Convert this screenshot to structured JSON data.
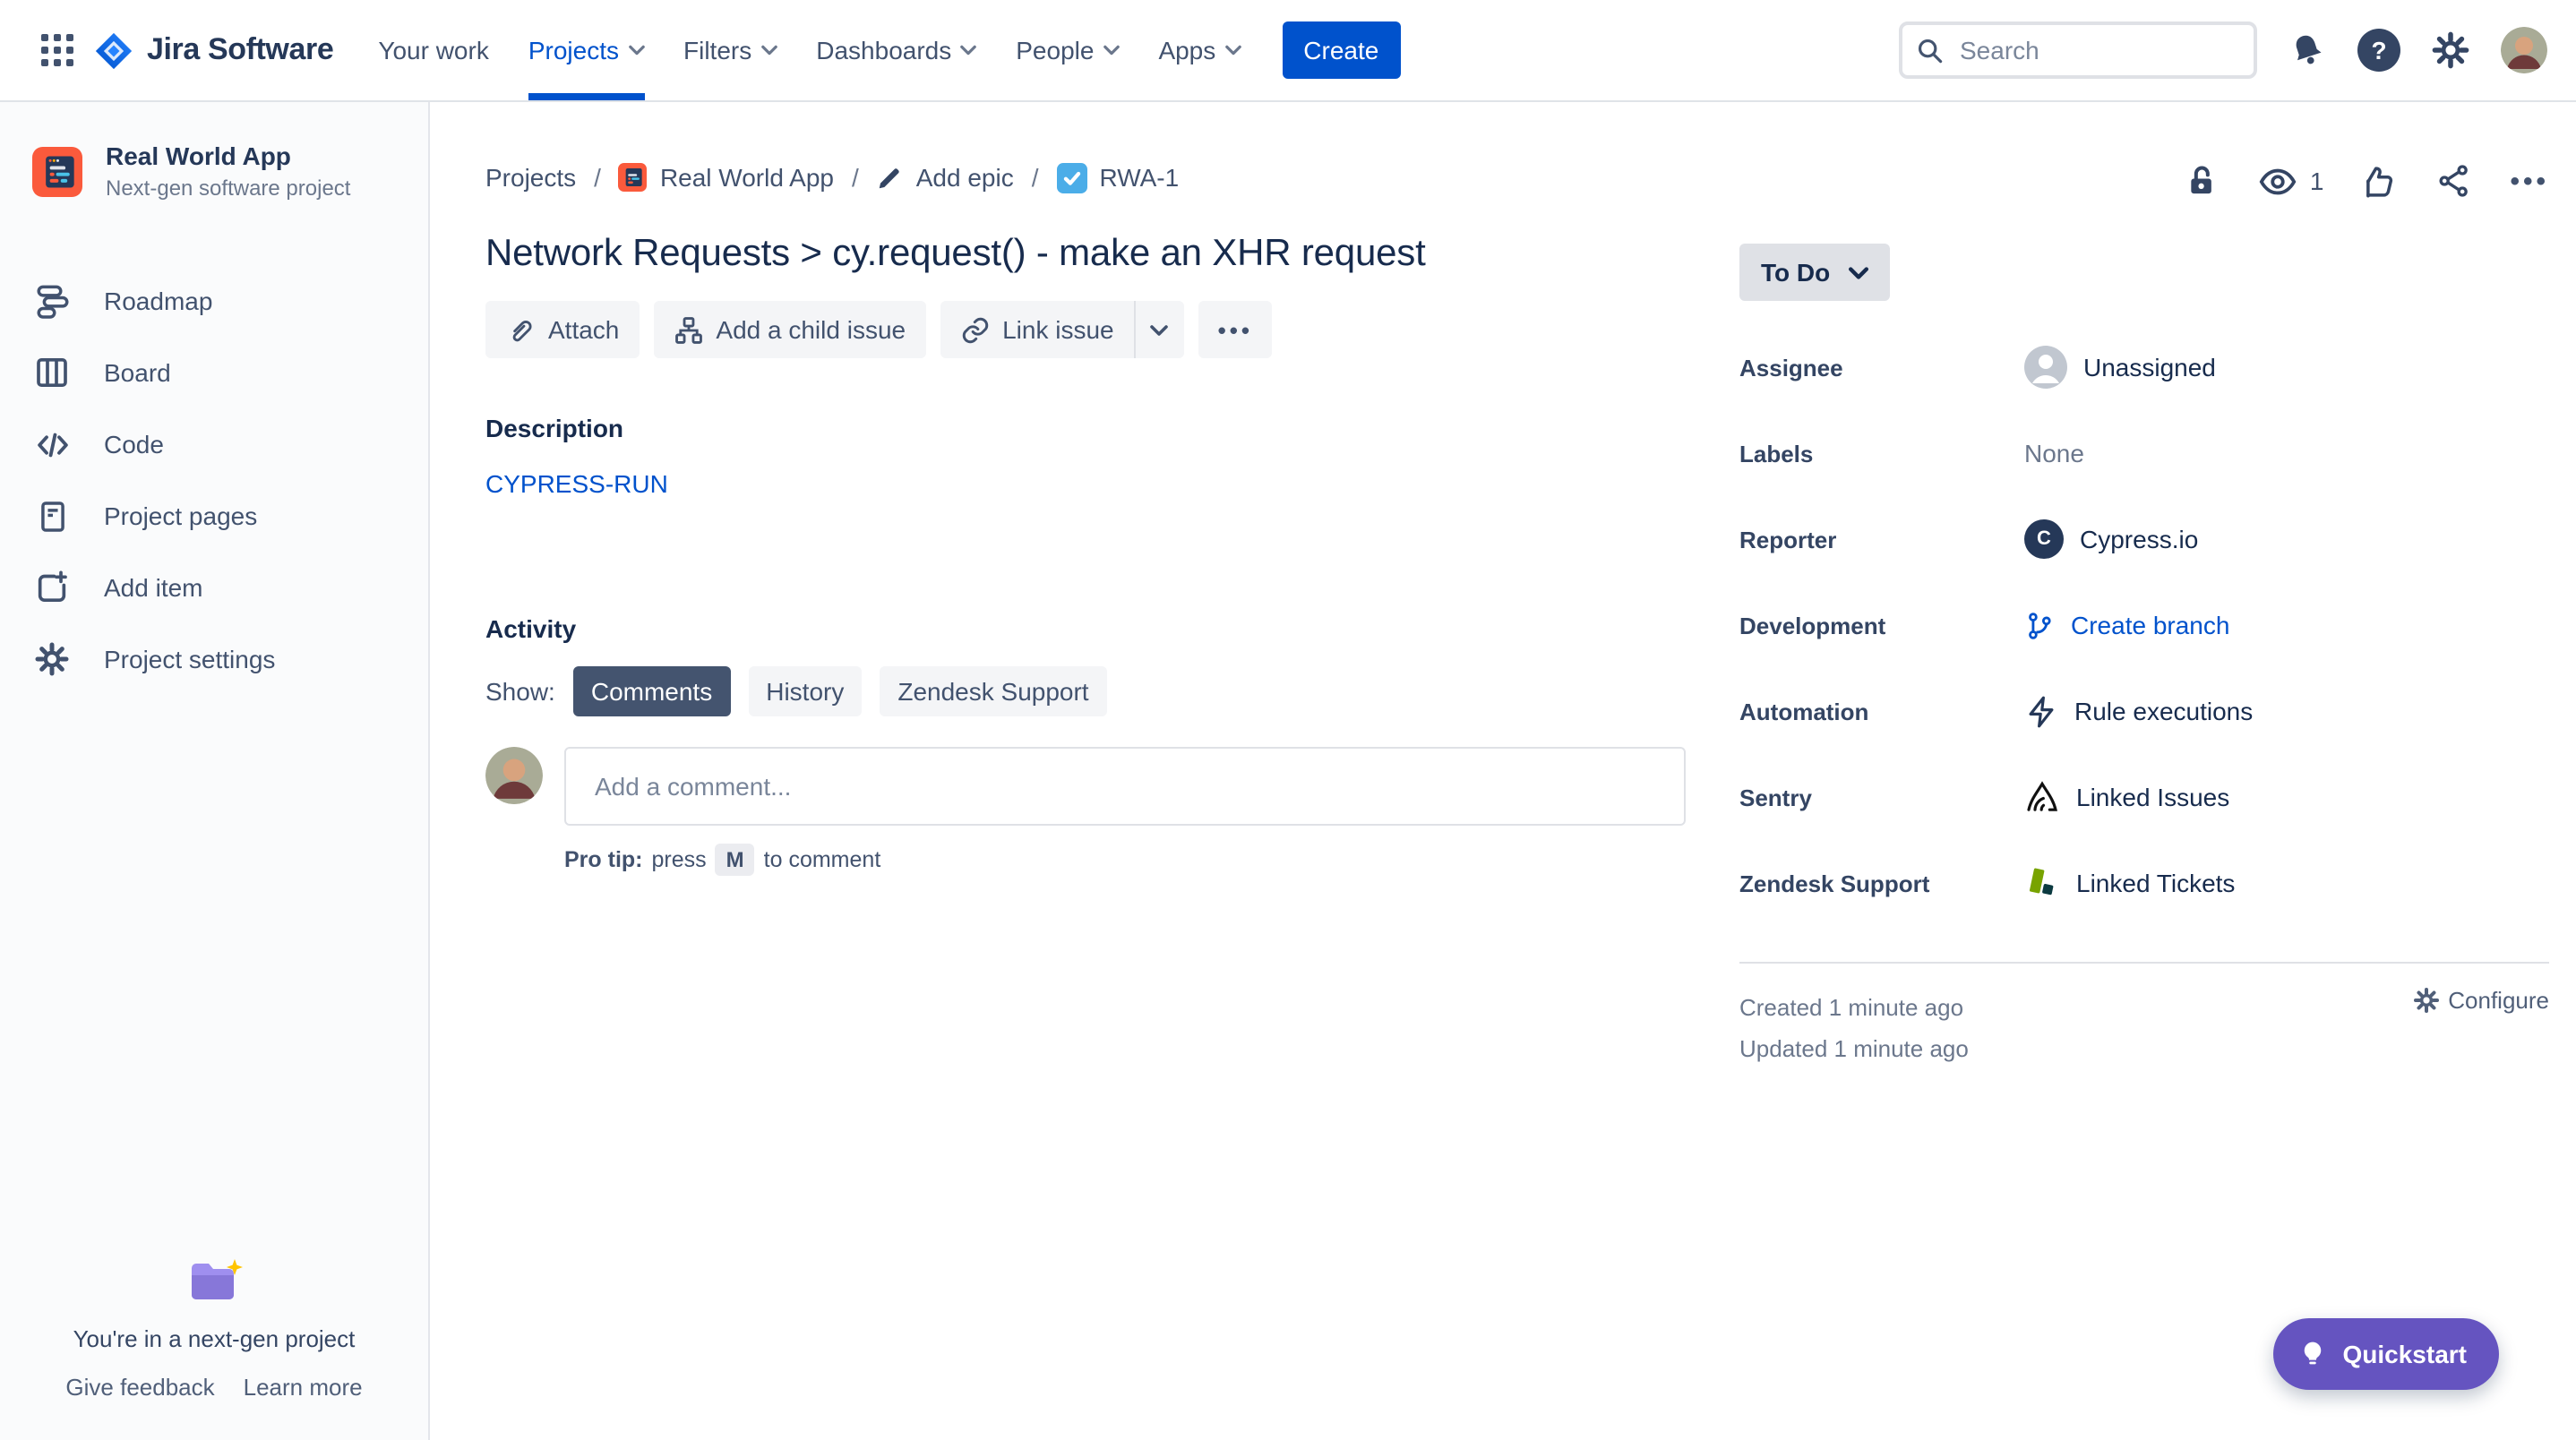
{
  "topnav": {
    "app_name": "Jira Software",
    "items": [
      {
        "label": "Your work",
        "chevron": false,
        "active": false
      },
      {
        "label": "Projects",
        "chevron": true,
        "active": true
      },
      {
        "label": "Filters",
        "chevron": true,
        "active": false
      },
      {
        "label": "Dashboards",
        "chevron": true,
        "active": false
      },
      {
        "label": "People",
        "chevron": true,
        "active": false
      },
      {
        "label": "Apps",
        "chevron": true,
        "active": false
      }
    ],
    "create_label": "Create",
    "search": {
      "placeholder": "Search"
    }
  },
  "sidebar": {
    "project": {
      "name": "Real World App",
      "type": "Next-gen software project"
    },
    "items": [
      {
        "label": "Roadmap"
      },
      {
        "label": "Board"
      },
      {
        "label": "Code"
      },
      {
        "label": "Project pages"
      },
      {
        "label": "Add item"
      },
      {
        "label": "Project settings"
      }
    ],
    "footer": {
      "message": "You're in a next-gen project",
      "give_feedback": "Give feedback",
      "learn_more": "Learn more"
    }
  },
  "breadcrumb": {
    "projects": "Projects",
    "project": "Real World App",
    "add_epic": "Add epic",
    "issue_key": "RWA-1"
  },
  "issue": {
    "title": "Network Requests > cy.request() - make an XHR request",
    "actions": {
      "attach": "Attach",
      "add_child": "Add a child issue",
      "link": "Link issue"
    },
    "description": {
      "heading": "Description",
      "link_text": "CYPRESS-RUN"
    },
    "activity": {
      "heading": "Activity",
      "show_label": "Show:",
      "tabs": [
        {
          "label": "Comments",
          "active": true
        },
        {
          "label": "History",
          "active": false
        },
        {
          "label": "Zendesk Support",
          "active": false
        }
      ],
      "comment_placeholder": "Add a comment...",
      "pro_tip": {
        "prefix": "Pro tip:",
        "press": "press",
        "key": "M",
        "suffix": "to comment"
      }
    },
    "header_icons": {
      "watchers_count": "1"
    },
    "status": {
      "label": "To Do"
    }
  },
  "details": {
    "fields": [
      {
        "label": "Assignee",
        "value": "Unassigned"
      },
      {
        "label": "Labels",
        "value": "None"
      },
      {
        "label": "Reporter",
        "value": "Cypress.io",
        "avatar_letter": "C"
      },
      {
        "label": "Development",
        "value": "Create branch"
      },
      {
        "label": "Automation",
        "value": "Rule executions"
      },
      {
        "label": "Sentry",
        "value": "Linked Issues"
      },
      {
        "label": "Zendesk Support",
        "value": "Linked Tickets"
      }
    ],
    "created": "Created 1 minute ago",
    "updated": "Updated 1 minute ago",
    "configure": "Configure"
  },
  "quickstart": {
    "label": "Quickstart"
  },
  "colors": {
    "accent_blue": "#0052CC",
    "purple": "#6554C0",
    "issue_type_blue": "#4BADE8",
    "project_orange": "#FA5A3C",
    "zendesk_green": "#78A300",
    "selected_tab": "#44546F",
    "status_bg": "#DFE1E6"
  }
}
